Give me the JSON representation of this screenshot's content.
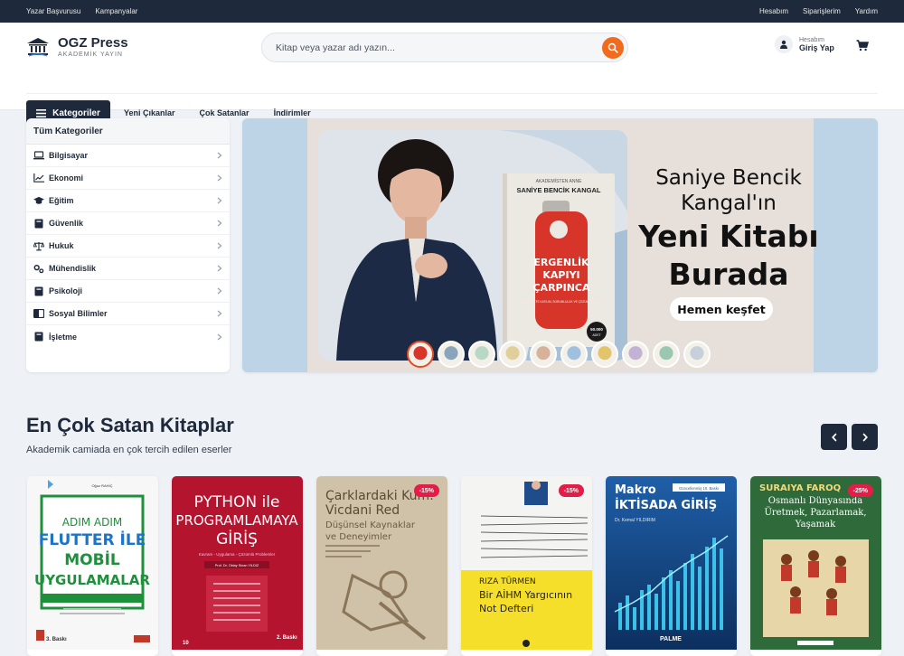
{
  "topbar": {
    "left_links": [
      "Yazar Başvurusu",
      "Kampanyalar"
    ],
    "right_links": [
      "Hesabım",
      "Siparişlerim",
      "Yardım"
    ]
  },
  "brand": {
    "name": "OGZ Press",
    "tagline": "AKADEMİK YAYIN"
  },
  "search": {
    "placeholder": "Kitap veya yazar adı yazın..."
  },
  "account": {
    "small": "Hesabım",
    "label": "Giriş Yap"
  },
  "nav": {
    "categories_button": "Kategoriler",
    "links": [
      "Yeni Çıkanlar",
      "Çok Satanlar",
      "İndirimler"
    ]
  },
  "sidebar": {
    "title": "Tüm Kategoriler",
    "items": [
      {
        "label": "Bilgisayar",
        "icon": "laptop-icon"
      },
      {
        "label": "Ekonomi",
        "icon": "chart-line-icon"
      },
      {
        "label": "Eğitim",
        "icon": "graduation-cap-icon"
      },
      {
        "label": "Güvenlik",
        "icon": "book-icon"
      },
      {
        "label": "Hukuk",
        "icon": "scale-icon"
      },
      {
        "label": "Mühendislik",
        "icon": "gears-icon"
      },
      {
        "label": "Psikoloji",
        "icon": "book-icon"
      },
      {
        "label": "Sosyal Bilimler",
        "icon": "open-book-icon"
      },
      {
        "label": "İşletme",
        "icon": "book-icon"
      }
    ]
  },
  "banner": {
    "headline_line1": "Saniye Bencik",
    "headline_line2": "Kangal'ın",
    "headline_big1": "Yeni Kitabı",
    "headline_big2": "Burada",
    "cta": "Hemen keşfet",
    "book_series": "AKADEMİSTEN ANNE",
    "book_author": "SANİYE BENCİK KANGAL",
    "book_title": [
      "ERGENLİK",
      "KAPIYI",
      "ÇARPINCA"
    ],
    "book_subtitle": "ERGENLİKTE KATILIM, SORUMLULUK VE ÇÖZÜM YOLLARI",
    "book_badge": [
      "50.000",
      "ADET"
    ],
    "thumb_count": 10,
    "active_thumb": 0
  },
  "section": {
    "title": "En Çok Satan Kitaplar",
    "subtitle": "Akademik camiada en çok tercih edilen eserler"
  },
  "books": [
    {
      "id": "b1",
      "discount": "",
      "title_lines": [
        "ADIM ADIM",
        "FLUTTER İLE",
        "MOBİL",
        "UYGULAMALAR"
      ],
      "author": "Oğuz RAHİÇ",
      "edition": "3. Baskı"
    },
    {
      "id": "b2",
      "discount": "",
      "title_lines": [
        "PYTHON ile",
        "PROGRAMLAMAYA",
        "GİRİŞ"
      ],
      "subtitle": "Kavram - Uygulama - Çözümlü Problemler",
      "author": "Prof. Dr. Oktay Sinan YILDIZ",
      "edition": "2. Baskı"
    },
    {
      "id": "b3",
      "discount": "-15%",
      "title_lines": [
        "Çarklardaki Kum:",
        "Vicdani Red"
      ],
      "subtitle": [
        "Düşünsel Kaynaklar",
        "ve Deneyimler"
      ]
    },
    {
      "id": "b4",
      "discount": "-15%",
      "author": "RIZA TÜRMEN",
      "title_lines": [
        "Bir AİHM Yargıcının",
        "Not Defteri"
      ]
    },
    {
      "id": "b5",
      "discount": "",
      "title_lines": [
        "Makro",
        "İKTİSADA GİRİŞ"
      ],
      "edition_tag": "Güncellenmiş 10. Baskı",
      "author": "Dr. Kemal YILDIRIM",
      "publisher": "PALME"
    },
    {
      "id": "b6",
      "discount": "-25%",
      "author": "SURAIYA FAROQ",
      "title_lines": [
        "Osmanlı Dünyasında",
        "Üretmek, Pazarlamak,",
        "Yaşamak"
      ]
    }
  ]
}
